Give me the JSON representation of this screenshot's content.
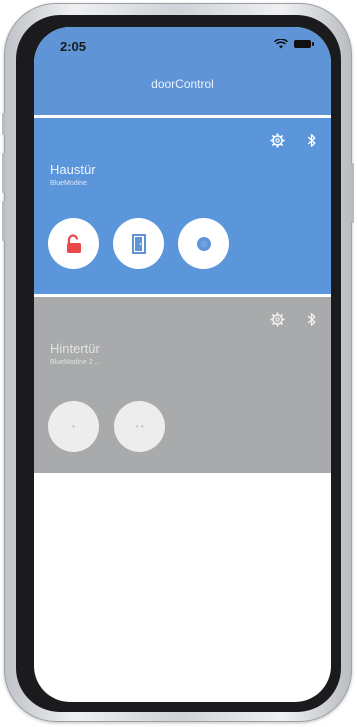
{
  "status_bar": {
    "time": "2:05"
  },
  "header": {
    "title": "doorControl"
  },
  "devices": [
    {
      "name": "Haustür",
      "subtitle": "BlueModine",
      "color": "#5b95da"
    },
    {
      "name": "Hintertür",
      "subtitle": "BlueModine 2 ...",
      "color": "#a8aaab"
    }
  ],
  "colors": {
    "accent": "#5f95d6",
    "unlock": "#e84a4a",
    "door": "#5f95d6",
    "disabled": "#a8aaab"
  },
  "icons": [
    "gear-icon",
    "bluetooth-icon",
    "unlock-icon",
    "door-icon",
    "circle-icon"
  ]
}
